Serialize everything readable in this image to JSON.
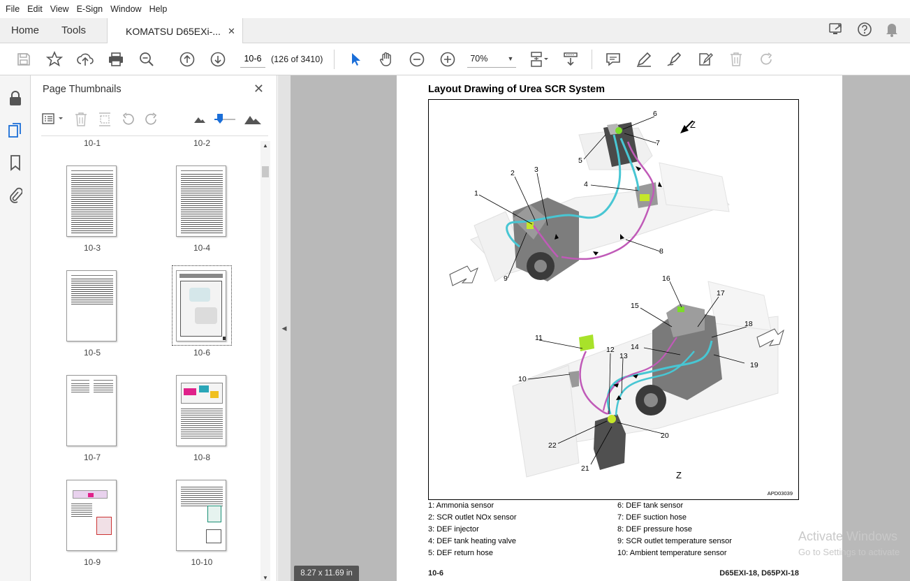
{
  "menu": [
    "File",
    "Edit",
    "View",
    "E-Sign",
    "Window",
    "Help"
  ],
  "tabs": {
    "home": "Home",
    "tools": "Tools",
    "document": "KOMATSU D65EXi-...",
    "close": "✕"
  },
  "toolbar": {
    "page_number": "10-6",
    "page_count": "(126 of 3410)",
    "zoom": "70%"
  },
  "thumbnails": {
    "title": "Page Thumbnails",
    "close": "✕",
    "labels": [
      "10-1",
      "10-2",
      "10-3",
      "10-4",
      "10-5",
      "10-6",
      "10-7",
      "10-8",
      "10-9",
      "10-10"
    ],
    "selected": "10-6"
  },
  "document": {
    "title": "Layout Drawing of Urea SCR System",
    "figure_code": "APD03039",
    "view_label": "Z",
    "callouts": [
      "1",
      "2",
      "3",
      "4",
      "5",
      "6",
      "7",
      "8",
      "9",
      "10",
      "11",
      "12",
      "13",
      "14",
      "15",
      "16",
      "17",
      "18",
      "19",
      "20",
      "21",
      "22"
    ],
    "legend": [
      "1: Ammonia sensor",
      "2: SCR outlet NOx sensor",
      "3: DEF injector",
      "4: DEF tank heating valve",
      "5: DEF return hose",
      "6: DEF tank sensor",
      "7: DEF suction hose",
      "8: DEF pressure hose",
      "9: SCR outlet temperature sensor",
      "10: Ambient temperature sensor"
    ],
    "footer_left": "10-6",
    "footer_right": "D65EXI-18, D65PXI-18"
  },
  "page_size": "8.27 x 11.69 in",
  "watermark": {
    "line1": "Activate Windows",
    "line2": "Go to Settings to activate"
  }
}
